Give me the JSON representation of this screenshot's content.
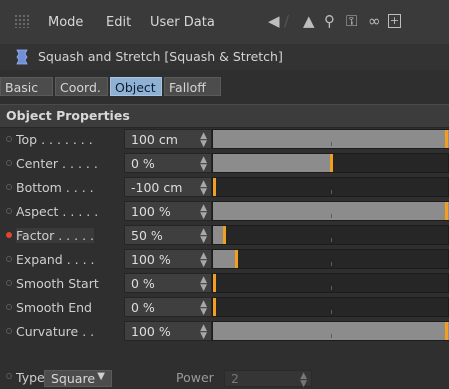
{
  "menubar": {
    "items": [
      "Mode",
      "Edit",
      "User Data"
    ]
  },
  "title": {
    "text": "Squash and Stretch [Squash & Stretch]"
  },
  "tabs": [
    {
      "label": "Basic",
      "active": false
    },
    {
      "label": "Coord.",
      "active": false
    },
    {
      "label": "Object",
      "active": true
    },
    {
      "label": "Falloff",
      "active": false
    }
  ],
  "section": {
    "title": "Object Properties"
  },
  "properties": [
    {
      "label": "Top . . . . . . .",
      "value": "100 cm",
      "fraction": 1.0,
      "active": false
    },
    {
      "label": "Center . . . . .",
      "value": "0 %",
      "fraction": 0.5,
      "active": false
    },
    {
      "label": "Bottom . . . .",
      "value": "-100 cm",
      "fraction": 0.0,
      "active": false
    },
    {
      "label": "Aspect . . . . .",
      "value": "100 %",
      "fraction": 1.0,
      "active": false
    },
    {
      "label": "Factor . . . . .",
      "value": "50 %",
      "fraction": 0.05,
      "active": true
    },
    {
      "label": "Expand . . . .",
      "value": "100 %",
      "fraction": 0.1,
      "active": false
    },
    {
      "label": "Smooth Start",
      "value": "0 %",
      "fraction": 0.0,
      "active": false
    },
    {
      "label": "Smooth End",
      "value": "0 %",
      "fraction": 0.0,
      "active": false
    },
    {
      "label": "Curvature . .",
      "value": "100 %",
      "fraction": 1.0,
      "active": false
    }
  ],
  "type_row": {
    "label": "Type",
    "selected": "Square",
    "power_label": "Power",
    "power_value": "2"
  },
  "colors": {
    "accent": "#f0a01e",
    "tab_active": "#8fb1d4",
    "animated_dot": "#e0462f"
  }
}
